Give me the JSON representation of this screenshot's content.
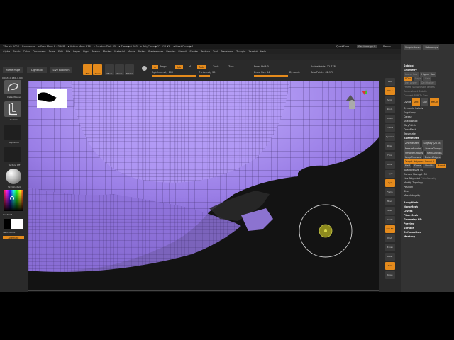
{
  "title_bar": {
    "items": [
      "ZBrush 2020",
      "Bobcamps",
      "• Free Mem 8.433GB",
      "• Active Mem 836",
      "• Scratch Disk 45",
      "• Timer▶0.003",
      "• PolyCount▶12.512 KP",
      "• MeshCount▶1"
    ],
    "quicksave": "QuickSave",
    "seethrough": "See-through 0",
    "menus": "Menus",
    "script": "DefaultZScript"
  },
  "menu_bar": [
    "Alpha",
    "Brush",
    "Color",
    "Document",
    "Draw",
    "Edit",
    "File",
    "Layer",
    "Light",
    "Macro",
    "Marker",
    "Material",
    "Movie",
    "Picker",
    "Preferences",
    "Render",
    "Stencil",
    "Stroke",
    "Texture",
    "Tool",
    "Transform",
    "Zplugin",
    "Zscript",
    "Help"
  ],
  "shelf": {
    "home": "Home Page",
    "lightbox": "LightBox",
    "live_boolean": "Live Boolean",
    "tools": [
      {
        "label": "Edit",
        "on": true
      },
      {
        "label": "Draw",
        "on": true
      },
      {
        "label": "Move",
        "on": false
      },
      {
        "label": "Scale",
        "on": false
      },
      {
        "label": "Rotate",
        "on": false
      }
    ],
    "a": "A",
    "mrgb": "Mrgb",
    "rgb": "Rgb",
    "m": "M",
    "zadd": "Zadd",
    "zsub": "Zsub",
    "zcut": "Zcut",
    "rgb_intensity": "Rgb Intensity 100",
    "z_intensity": "Z Intensity 25",
    "focal_shift": "Focal Shift 0",
    "draw_size": "Draw Size 64",
    "dynamic": "Dynamic",
    "active_points": "ActivePoints: 12.778",
    "total_points": "TotalPoints: 62.970"
  },
  "left_shelf": {
    "coords": "0.063,-0.136,-0.634",
    "brush": "DefaultLasso",
    "stroke": "Outlines",
    "alpha": "Alpha Off",
    "texture": "Texture Off",
    "material": "SkinShade4",
    "gradient": "Gradient",
    "switch_color": "SwitchColor",
    "alternate": "Alternate"
  },
  "right_toolbar": [
    "BPR",
    "SPix 3",
    "Scroll",
    "Zoom",
    "Actual",
    "AAHalf",
    "Dynamic",
    "Persp",
    "Floor",
    "Local",
    "L.Sym",
    "Gyz",
    "Frame",
    "Move",
    "Scale",
    "Rotate",
    "Line Fill",
    "PolyF",
    "Transp",
    "Ghost",
    "Solo",
    "Xpose"
  ],
  "right_panel": {
    "tabs": [
      "SimpleBrush",
      "Bobcamps"
    ],
    "subtool": "Subtool",
    "geometry": "Geometry",
    "lower_res": "Lower Res",
    "higher_res": "Higher Res",
    "sdiv": "SDiv",
    "cage": "Cage",
    "rstr": "Rstr",
    "del_lower": "Del Lower",
    "del_higher": "Del Higher",
    "freeze": "Freeze SubDivision Levels",
    "reconstruct": "Reconstruct Subdiv",
    "convert_bpr": "Convert BPR To Geo",
    "divide": "Divide",
    "smt": "Smt",
    "suv": "Suv",
    "rsmt": "ReUV",
    "dynamic_subdiv": "Dynamic Subdiv",
    "edgeloop": "EdgeLoop",
    "crease": "Crease",
    "shadowbox": "ShadowBox",
    "claypolish": "ClayPolish",
    "dynamesh": "DynaMesh",
    "tessimate": "Tessimate",
    "zremesher": "ZRemesher",
    "zremesher_btn": "ZRemesher",
    "legacy": "Legacy (2018)",
    "freeze_border": "FreezeBorder",
    "freeze_groups": "FreezeGroups",
    "smooth_groups": "SmoothGroups",
    "keep_groups": "KeepGroups",
    "keep_creases": "KeepCreases",
    "detect_edges": "DetectEdges",
    "target_polygons": "Target Polygons Count 5",
    "half": "Half",
    "same": "Same",
    "double": "Double",
    "adapt": "Adapt",
    "adaptive_size": "AdaptiveSize 50",
    "curves_strength": "Curves Strength 50",
    "use_polypaint": "Use Polypaint",
    "color_density": "ColorDensity",
    "modify_topology": "Modify Topology",
    "position": "Position",
    "size": "Size",
    "mesh_integrity": "MeshIntegrity",
    "array_mesh": "ArrayMesh",
    "nano_mesh": "NanoMesh",
    "layers": "Layers",
    "fiber_mesh": "FiberMesh",
    "geometry_hd": "Geometry HD",
    "preview": "Preview",
    "surface": "Surface",
    "deformation": "Deformation",
    "masking": "Masking"
  },
  "colors": {
    "accent": "#e48a1c",
    "mesh": "#9a7ee6",
    "wire": "#3b2b66"
  }
}
